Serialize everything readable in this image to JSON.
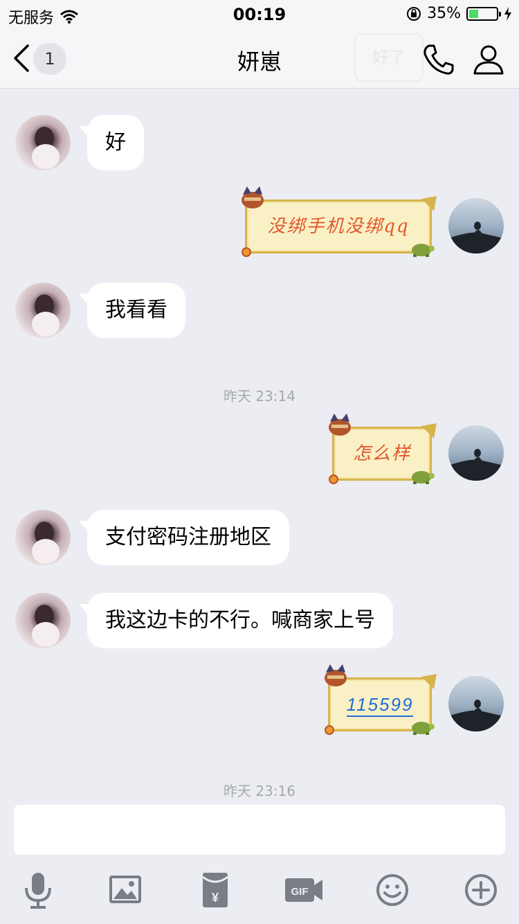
{
  "status_bar": {
    "carrier": "无服务",
    "time": "00:19",
    "battery_percent": "35%",
    "battery_level": 0.35
  },
  "nav": {
    "unread_count": "1",
    "title": "妍崽",
    "watermark": "好了"
  },
  "messages": [
    {
      "from": "other",
      "type": "text",
      "text": "好"
    },
    {
      "from": "me",
      "type": "sticker",
      "text": "没绑手机没绑qq"
    },
    {
      "from": "other",
      "type": "text",
      "text": "我看看"
    },
    {
      "type": "time",
      "text": "昨天 23:14"
    },
    {
      "from": "me",
      "type": "sticker",
      "text": "怎么样"
    },
    {
      "from": "other",
      "type": "text",
      "text": "支付密码注册地区"
    },
    {
      "from": "other",
      "type": "text",
      "text": "我这边卡的不行。喊商家上号"
    },
    {
      "from": "me",
      "type": "sticker",
      "text": "115599"
    },
    {
      "type": "time",
      "text": "昨天 23:16"
    }
  ],
  "input": {
    "value": "",
    "placeholder": ""
  },
  "toolbar_icons": [
    "microphone-icon",
    "image-icon",
    "red-packet-icon",
    "gif-icon",
    "emoji-icon",
    "plus-icon"
  ],
  "colors": {
    "background": "#ebedf2",
    "bar": "#f6f6f8",
    "battery_fill": "#4cd964",
    "sticker_text": "#e2572a",
    "sticker_link": "#1e6fd6"
  }
}
